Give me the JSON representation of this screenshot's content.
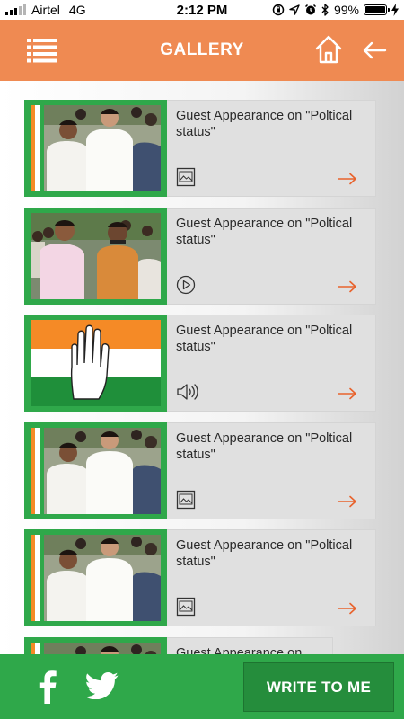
{
  "status_bar": {
    "carrier": "Airtel",
    "network": "4G",
    "time": "2:12 PM",
    "battery": "99%",
    "battery_level": 0.99
  },
  "header": {
    "title": "GALLERY",
    "menu_icon": "hamburger-menu-icon",
    "home_icon": "home-icon",
    "back_icon": "back-arrow-icon"
  },
  "colors": {
    "header": "#ef8a52",
    "green": "#2fa84a",
    "arrow": "#e8622c"
  },
  "gallery": {
    "items": [
      {
        "title": "Guest Appearance on \"Poltical status\"",
        "media": "image-icon",
        "thumb": "photo-a"
      },
      {
        "title": "Guest Appearance on \"Poltical status\"",
        "media": "play-icon",
        "thumb": "photo-b"
      },
      {
        "title": "Guest Appearance on \"Poltical status\"",
        "media": "speaker-icon",
        "thumb": "flag-hand"
      },
      {
        "title": "Guest Appearance on \"Poltical status\"",
        "media": "image-icon",
        "thumb": "photo-a"
      },
      {
        "title": "Guest Appearance on \"Poltical status\"",
        "media": "image-icon",
        "thumb": "photo-a"
      },
      {
        "title": "Guest Appearance on",
        "media": "",
        "thumb": "photo-a"
      }
    ]
  },
  "footer": {
    "facebook_icon": "facebook-icon",
    "twitter_icon": "twitter-icon",
    "write_label": "WRITE TO ME"
  }
}
